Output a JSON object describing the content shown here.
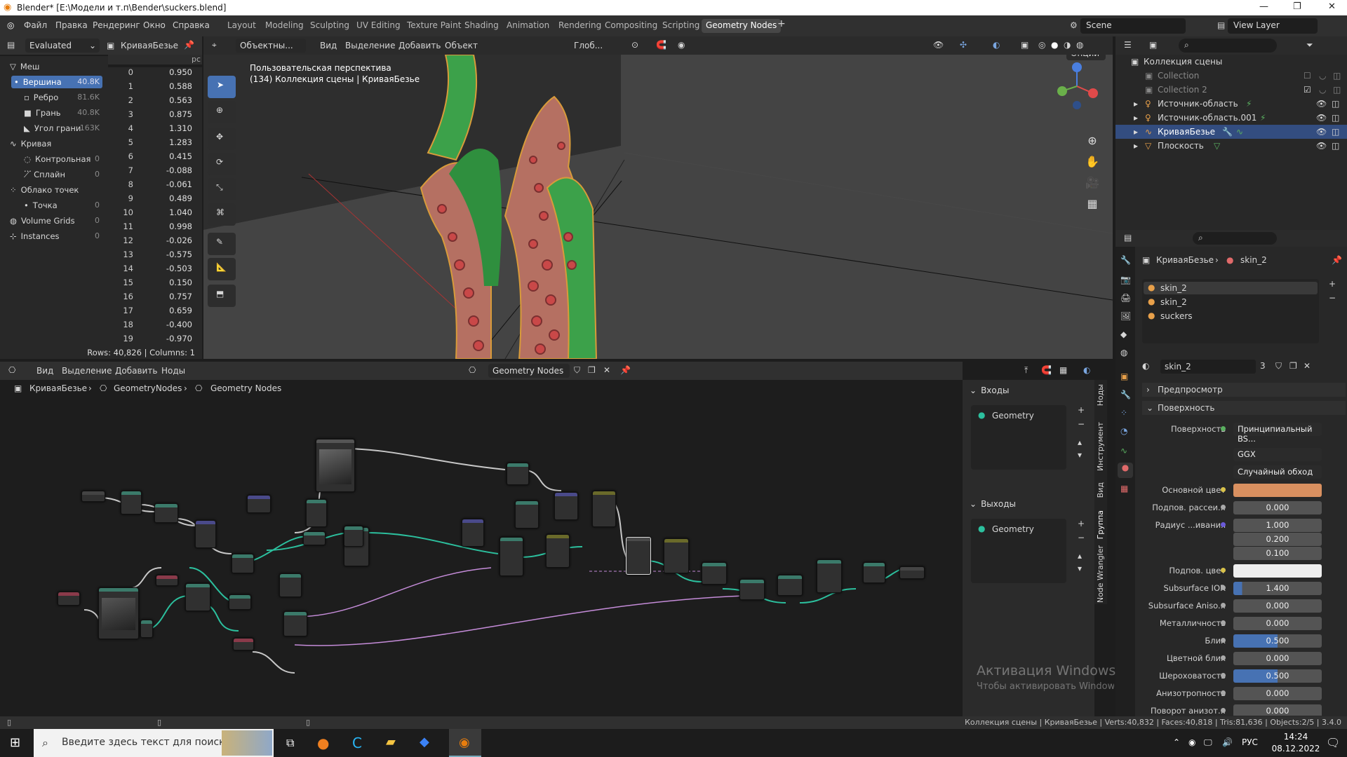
{
  "window": {
    "title": "Blender* [E:\\Модели и т.п\\Bender\\suckers.blend]"
  },
  "menu": [
    "Файл",
    "Правка",
    "Рендеринг",
    "Окно",
    "Справка"
  ],
  "workspaces": [
    "Layout",
    "Modeling",
    "Sculpting",
    "UV Editing",
    "Texture Paint",
    "Shading",
    "Animation",
    "Rendering",
    "Compositing",
    "Scripting",
    "Geometry Nodes"
  ],
  "active_workspace": "Geometry Nodes",
  "scene": "Scene",
  "view_layer": "View Layer",
  "spreadsheet": {
    "mode": "Evaluated",
    "object": "КриваяБезье",
    "col_hint": "рс",
    "domains": [
      {
        "label": "Меш",
        "count": ""
      },
      {
        "label": "Вершина",
        "count": "40.8K"
      },
      {
        "label": "Ребро",
        "count": "81.6K"
      },
      {
        "label": "Грань",
        "count": "40.8K"
      },
      {
        "label": "Угол грани",
        "count": "163K"
      },
      {
        "label": "Кривая",
        "count": ""
      },
      {
        "label": "Контрольная ...",
        "count": "0"
      },
      {
        "label": "Сплайн",
        "count": "0"
      },
      {
        "label": "Облако точек",
        "count": ""
      },
      {
        "label": "Точка",
        "count": "0"
      },
      {
        "label": "Volume Grids",
        "count": "0"
      },
      {
        "label": "Instances",
        "count": "0"
      }
    ],
    "rows": [
      [
        "0",
        "0.950"
      ],
      [
        "1",
        "0.588"
      ],
      [
        "2",
        "0.563"
      ],
      [
        "3",
        "0.875"
      ],
      [
        "4",
        "1.310"
      ],
      [
        "5",
        "1.283"
      ],
      [
        "6",
        "0.415"
      ],
      [
        "7",
        "-0.088"
      ],
      [
        "8",
        "-0.061"
      ],
      [
        "9",
        "0.489"
      ],
      [
        "10",
        "1.040"
      ],
      [
        "11",
        "0.998"
      ],
      [
        "12",
        "-0.026"
      ],
      [
        "13",
        "-0.575"
      ],
      [
        "14",
        "-0.503"
      ],
      [
        "15",
        "0.150"
      ],
      [
        "16",
        "0.757"
      ],
      [
        "17",
        "0.659"
      ],
      [
        "18",
        "-0.400"
      ],
      [
        "19",
        "-0.970"
      ]
    ],
    "footer": "Rows: 40,826   |   Columns: 1"
  },
  "viewport": {
    "mode": "Объектны...",
    "menus": [
      "Вид",
      "Выделение",
      "Добавить",
      "Объект"
    ],
    "transform": "Глоб...",
    "options": "Опции",
    "overlay_line1": "Пользовательская перспектива",
    "overlay_line2": "(134) Коллекция сцены | КриваяБезье"
  },
  "outliner": {
    "items": [
      {
        "label": "Коллекция сцены"
      },
      {
        "label": "Collection"
      },
      {
        "label": "Collection 2"
      },
      {
        "label": "Источник-область"
      },
      {
        "label": "Источник-область.001"
      },
      {
        "label": "КриваяБезье"
      },
      {
        "label": "Плоскость"
      }
    ]
  },
  "properties": {
    "breadcrumb_obj": "КриваяБезье",
    "breadcrumb_mat": "skin_2",
    "slots": [
      "skin_2",
      "skin_2",
      "suckers"
    ],
    "material_name": "skin_2",
    "users": "3",
    "sections": {
      "preview": "Предпросмотр",
      "surface": "Поверхность"
    },
    "surface_label": "Поверхность",
    "surface_value": "Принципиальный BS...",
    "distribution": "GGX",
    "subsurface_method": "Случайный обход",
    "rows": [
      {
        "label": "Основной цвет",
        "value": ""
      },
      {
        "label": "Подпов. рассеи...",
        "value": "0.000"
      },
      {
        "label": "Радиус ...ивания",
        "value": "1.000"
      },
      {
        "label": "",
        "value": "0.200"
      },
      {
        "label": "",
        "value": "0.100"
      },
      {
        "label": "Подпов. цвет",
        "value": ""
      },
      {
        "label": "Subsurface IOR",
        "value": "1.400"
      },
      {
        "label": "Subsurface Aniso...",
        "value": "0.000"
      },
      {
        "label": "Металличность",
        "value": "0.000"
      },
      {
        "label": "Блик",
        "value": "0.500"
      },
      {
        "label": "Цветной блик",
        "value": "0.000"
      },
      {
        "label": "Шероховатость",
        "value": "0.500"
      },
      {
        "label": "Анизотропность",
        "value": "0.000"
      },
      {
        "label": "Поворот анизот...",
        "value": "0.000"
      }
    ],
    "colors": {
      "base": "#d99060",
      "subsurface": "#eeeeee",
      "accent": "#4772b3"
    }
  },
  "node_editor": {
    "menus": [
      "Вид",
      "Выделение",
      "Добавить",
      "Ноды"
    ],
    "tree": "Geometry Nodes",
    "breadcrumb": [
      "КриваяБезье",
      "GeometryNodes",
      "Geometry Nodes"
    ],
    "inputs_title": "Входы",
    "outputs_title": "Выходы",
    "input_socket": "Geometry",
    "output_socket": "Geometry",
    "side_tabs": [
      "Ноды",
      "Инструмент",
      "Вид",
      "Группа",
      "Node Wrangler"
    ]
  },
  "watermark": {
    "line1": "Активация Windows",
    "line2": "Чтобы активировать Windows, перейдите в раздел \"Параметры\"."
  },
  "status": "Коллекция сцены | КриваяБезье | Verts:40,832 | Faces:40,818 | Tris:81,636 | Objects:2/5 | 3.4.0",
  "taskbar": {
    "search": "Введите здесь текст для поиска",
    "time": "14:24",
    "date": "08.12.2022",
    "lang": "РУС"
  }
}
